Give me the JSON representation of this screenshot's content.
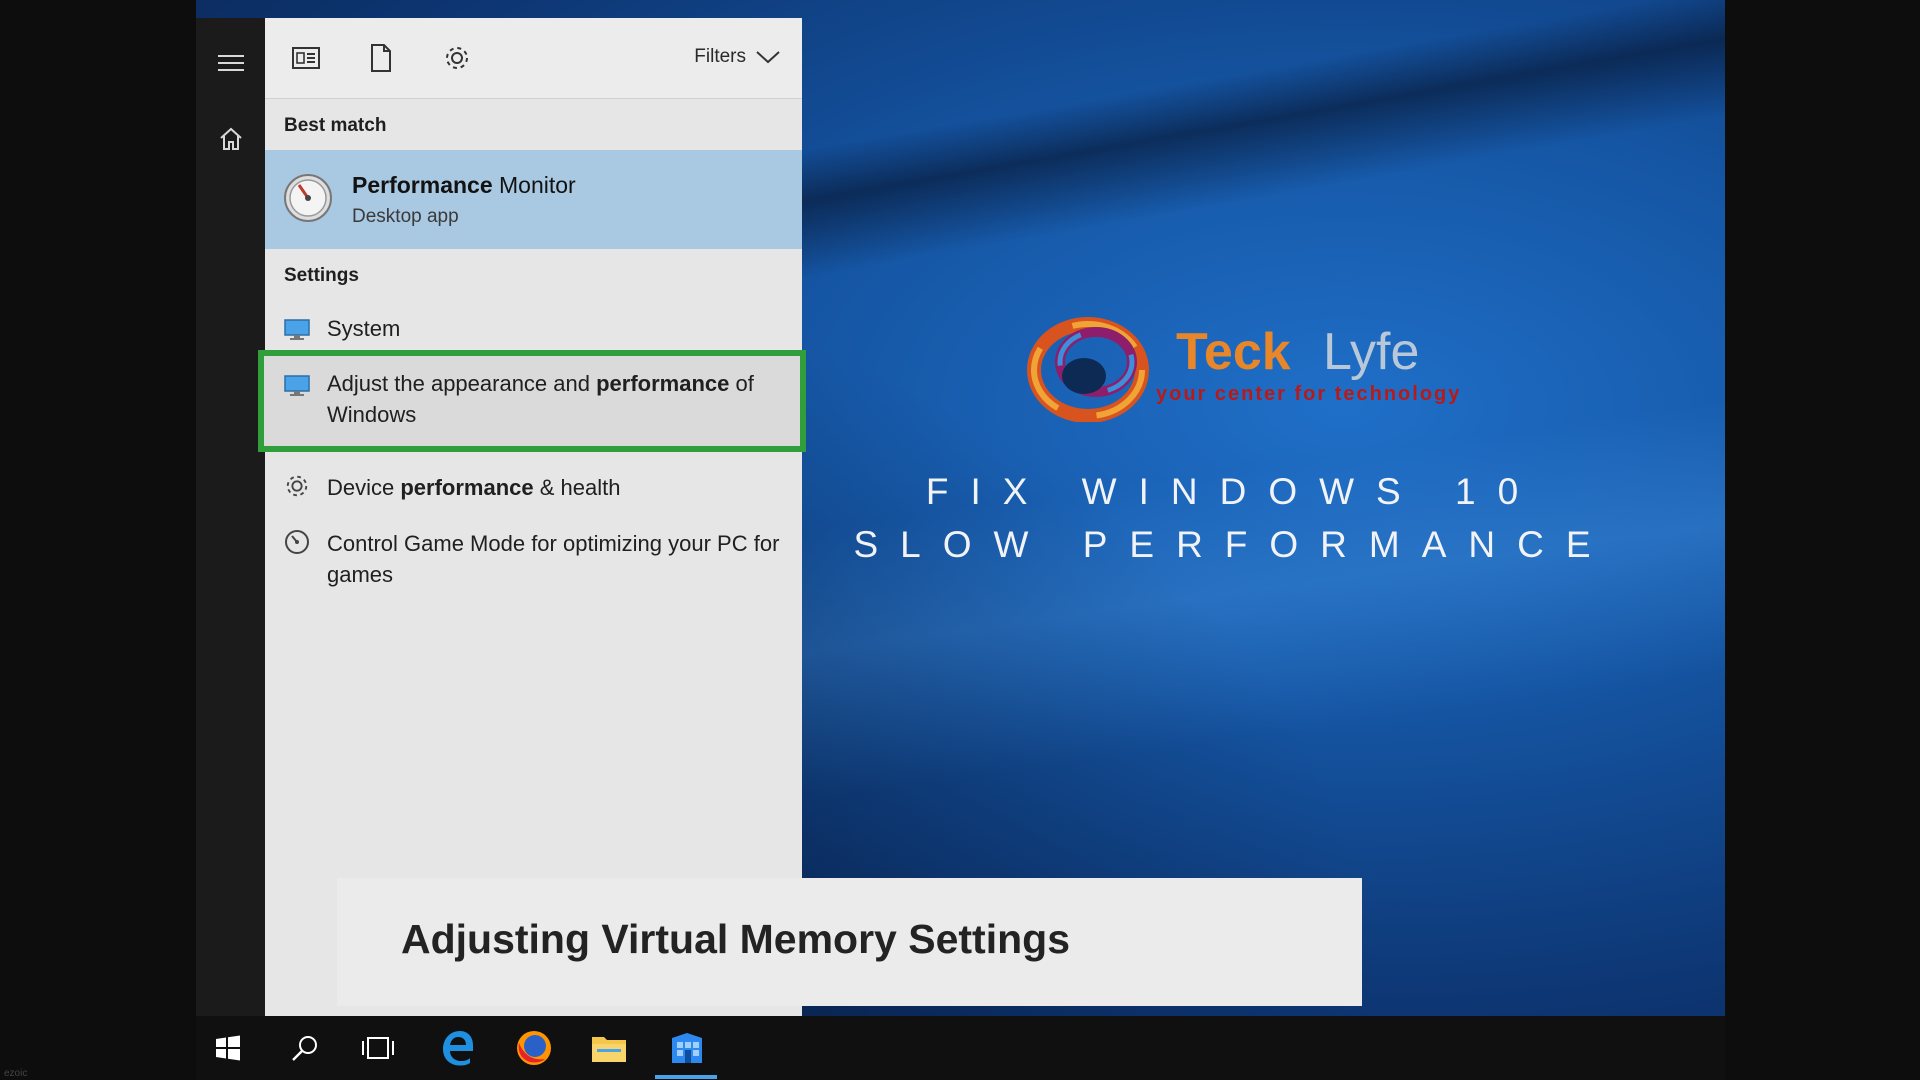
{
  "start_menu": {
    "rail": {
      "menu_icon": "hamburger-menu-icon",
      "home_icon": "home-icon"
    },
    "toolbar": {
      "apps_icon": "apps-filter-icon",
      "documents_icon": "document-filter-icon",
      "settings_icon": "gear-icon",
      "filters_label": "Filters"
    },
    "best_match": {
      "heading": "Best match",
      "app_title_bold": "Performance",
      "app_title_rest": " Monitor",
      "app_subtitle": "Desktop app"
    },
    "settings": {
      "heading": "Settings",
      "items": [
        {
          "icon": "system-monitor-icon",
          "pre": "System",
          "bold": "",
          "post": ""
        },
        {
          "icon": "system-monitor-icon",
          "pre": "Adjust the appearance and ",
          "bold": "performance",
          "post": " of Windows"
        },
        {
          "icon": "gear-icon",
          "pre": "Device ",
          "bold": "performance",
          "post": " & health"
        },
        {
          "icon": "game-mode-icon",
          "pre": "Control Game Mode for optimizing your PC for games",
          "bold": "",
          "post": ""
        }
      ]
    }
  },
  "desktop": {
    "logo_part1": "Teck",
    "logo_part2": "Lyfe",
    "logo_tagline": "your center for technology",
    "headline_line1": "FIX WINDOWS 10",
    "headline_line2": "SLOW PERFORMANCE"
  },
  "caption": {
    "text": "Adjusting Virtual Memory Settings"
  },
  "taskbar": {
    "apps": [
      "windows-start-icon",
      "search-icon",
      "task-view-icon",
      "edge-icon",
      "firefox-icon",
      "file-explorer-icon",
      "store-app-icon"
    ],
    "active_app": "store-app-icon"
  },
  "watermark": "ezoic",
  "colors": {
    "highlight_border": "#2f9e3b",
    "best_match_bg": "#a9c9e3",
    "logo_orange": "#e8862a",
    "tagline_red": "#b81a1a",
    "taskbar_accent": "#4aa3e8"
  }
}
